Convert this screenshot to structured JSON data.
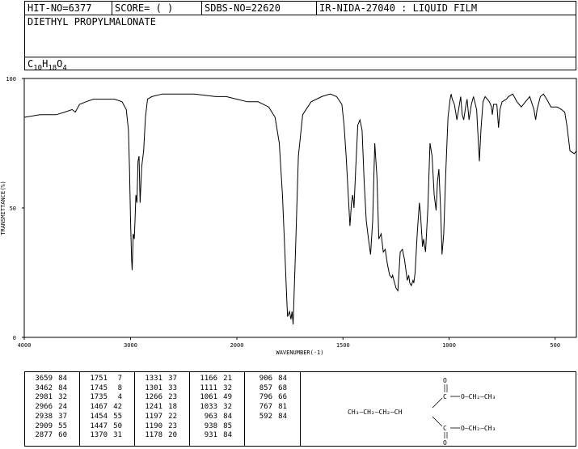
{
  "header": {
    "hit_no": "HIT-NO=6377",
    "score": "SCORE=  (   )",
    "sdbs_no": "SDBS-NO=22620",
    "ir_nida": "IR-NIDA-27040 : LIQUID FILM",
    "compound_name": "DIETHYL PROPYLMALONATE",
    "formula": {
      "c": "C",
      "c_n": "10",
      "h": "H",
      "h_n": "18",
      "o": "O",
      "o_n": "4"
    }
  },
  "chart_data": {
    "type": "line",
    "xlabel": "WAVENUMBER(-1)",
    "ylabel": "TRANSMITTANCE(%)",
    "xlim": [
      4000,
      400
    ],
    "ylim": [
      0,
      100
    ],
    "x_ticks": [
      4000,
      3000,
      2000,
      1500,
      1000,
      500
    ],
    "y_ticks": [
      0,
      50,
      100
    ],
    "grid": false,
    "series": [
      {
        "values": [
          [
            4000,
            85
          ],
          [
            3850,
            86
          ],
          [
            3700,
            86
          ],
          [
            3620,
            87
          ],
          [
            3550,
            88
          ],
          [
            3520,
            87
          ],
          [
            3480,
            90
          ],
          [
            3420,
            91
          ],
          [
            3350,
            92
          ],
          [
            3250,
            92
          ],
          [
            3150,
            92
          ],
          [
            3080,
            91
          ],
          [
            3040,
            88
          ],
          [
            3020,
            80
          ],
          [
            3010,
            65
          ],
          [
            3000,
            45
          ],
          [
            2990,
            30
          ],
          [
            2985,
            26
          ],
          [
            2975,
            40
          ],
          [
            2965,
            38
          ],
          [
            2958,
            45
          ],
          [
            2950,
            55
          ],
          [
            2940,
            52
          ],
          [
            2930,
            68
          ],
          [
            2920,
            70
          ],
          [
            2910,
            52
          ],
          [
            2895,
            66
          ],
          [
            2877,
            72
          ],
          [
            2860,
            85
          ],
          [
            2840,
            92
          ],
          [
            2800,
            93
          ],
          [
            2700,
            94
          ],
          [
            2600,
            94
          ],
          [
            2400,
            94
          ],
          [
            2200,
            93
          ],
          [
            2100,
            93
          ],
          [
            2000,
            92
          ],
          [
            1950,
            91
          ],
          [
            1900,
            91
          ],
          [
            1850,
            89
          ],
          [
            1820,
            85
          ],
          [
            1800,
            75
          ],
          [
            1785,
            55
          ],
          [
            1775,
            35
          ],
          [
            1765,
            15
          ],
          [
            1761,
            8
          ],
          [
            1752,
            10
          ],
          [
            1745,
            7
          ],
          [
            1740,
            10
          ],
          [
            1735,
            5
          ],
          [
            1725,
            30
          ],
          [
            1710,
            70
          ],
          [
            1690,
            86
          ],
          [
            1650,
            91
          ],
          [
            1600,
            93
          ],
          [
            1560,
            94
          ],
          [
            1530,
            93
          ],
          [
            1505,
            90
          ],
          [
            1495,
            82
          ],
          [
            1485,
            70
          ],
          [
            1475,
            55
          ],
          [
            1467,
            43
          ],
          [
            1460,
            52
          ],
          [
            1454,
            55
          ],
          [
            1448,
            50
          ],
          [
            1440,
            65
          ],
          [
            1430,
            82
          ],
          [
            1420,
            84
          ],
          [
            1410,
            80
          ],
          [
            1400,
            60
          ],
          [
            1390,
            45
          ],
          [
            1380,
            38
          ],
          [
            1370,
            32
          ],
          [
            1360,
            45
          ],
          [
            1350,
            75
          ],
          [
            1340,
            62
          ],
          [
            1331,
            38
          ],
          [
            1320,
            40
          ],
          [
            1310,
            33
          ],
          [
            1301,
            34
          ],
          [
            1290,
            28
          ],
          [
            1280,
            24
          ],
          [
            1270,
            23
          ],
          [
            1266,
            24
          ],
          [
            1260,
            22
          ],
          [
            1250,
            19
          ],
          [
            1241,
            18
          ],
          [
            1230,
            33
          ],
          [
            1220,
            34
          ],
          [
            1210,
            30
          ],
          [
            1197,
            22
          ],
          [
            1190,
            24
          ],
          [
            1185,
            21
          ],
          [
            1178,
            20
          ],
          [
            1170,
            22
          ],
          [
            1166,
            21
          ],
          [
            1160,
            25
          ],
          [
            1150,
            40
          ],
          [
            1140,
            52
          ],
          [
            1135,
            48
          ],
          [
            1125,
            35
          ],
          [
            1120,
            38
          ],
          [
            1111,
            33
          ],
          [
            1100,
            50
          ],
          [
            1090,
            75
          ],
          [
            1080,
            70
          ],
          [
            1070,
            55
          ],
          [
            1061,
            49
          ],
          [
            1055,
            60
          ],
          [
            1048,
            65
          ],
          [
            1040,
            50
          ],
          [
            1033,
            32
          ],
          [
            1025,
            40
          ],
          [
            1015,
            65
          ],
          [
            1005,
            85
          ],
          [
            995,
            92
          ],
          [
            990,
            94
          ],
          [
            985,
            92
          ],
          [
            975,
            90
          ],
          [
            963,
            84
          ],
          [
            955,
            88
          ],
          [
            945,
            93
          ],
          [
            938,
            86
          ],
          [
            931,
            84
          ],
          [
            920,
            90
          ],
          [
            915,
            92
          ],
          [
            906,
            84
          ],
          [
            895,
            90
          ],
          [
            885,
            93
          ],
          [
            870,
            88
          ],
          [
            857,
            68
          ],
          [
            850,
            80
          ],
          [
            840,
            91
          ],
          [
            830,
            93
          ],
          [
            820,
            92
          ],
          [
            810,
            91
          ],
          [
            800,
            89
          ],
          [
            796,
            86
          ],
          [
            790,
            90
          ],
          [
            775,
            90
          ],
          [
            767,
            81
          ],
          [
            760,
            88
          ],
          [
            750,
            91
          ],
          [
            730,
            92
          ],
          [
            720,
            93
          ],
          [
            700,
            94
          ],
          [
            680,
            91
          ],
          [
            660,
            89
          ],
          [
            640,
            91
          ],
          [
            620,
            93
          ],
          [
            600,
            88
          ],
          [
            592,
            84
          ],
          [
            585,
            88
          ],
          [
            570,
            93
          ],
          [
            555,
            94
          ],
          [
            540,
            92
          ],
          [
            520,
            89
          ],
          [
            490,
            89
          ],
          [
            470,
            88
          ],
          [
            455,
            87
          ],
          [
            445,
            82
          ],
          [
            430,
            72
          ],
          [
            410,
            71
          ],
          [
            400,
            72
          ]
        ]
      }
    ]
  },
  "peak_table": {
    "columns": [
      [
        [
          "3659",
          "84"
        ],
        [
          "3462",
          "84"
        ],
        [
          "2981",
          "32"
        ],
        [
          "2966",
          "24"
        ],
        [
          "2938",
          "37"
        ],
        [
          "2909",
          "55"
        ],
        [
          "2877",
          "60"
        ]
      ],
      [
        [
          "1751",
          "7"
        ],
        [
          "1745",
          "8"
        ],
        [
          "1735",
          "4"
        ],
        [
          "1467",
          "42"
        ],
        [
          "1454",
          "55"
        ],
        [
          "1447",
          "50"
        ],
        [
          "1370",
          "31"
        ]
      ],
      [
        [
          "1331",
          "37"
        ],
        [
          "1301",
          "33"
        ],
        [
          "1266",
          "23"
        ],
        [
          "1241",
          "18"
        ],
        [
          "1197",
          "22"
        ],
        [
          "1190",
          "23"
        ],
        [
          "1178",
          "20"
        ]
      ],
      [
        [
          "1166",
          "21"
        ],
        [
          "1111",
          "32"
        ],
        [
          "1061",
          "49"
        ],
        [
          "1033",
          "32"
        ],
        [
          "963",
          "84"
        ],
        [
          "938",
          "85"
        ],
        [
          "931",
          "84"
        ]
      ],
      [
        [
          "906",
          "84"
        ],
        [
          "857",
          "68"
        ],
        [
          "796",
          "66"
        ],
        [
          "767",
          "81"
        ],
        [
          "592",
          "84"
        ]
      ]
    ]
  },
  "structure": {
    "chain": "CH₃—CH₂—CH₂—CH",
    "top_o": "O",
    "top_c": "C",
    "top_tail": "O—CH₂—CH₃",
    "bot_c": "C",
    "bot_o": "O",
    "bot_tail": "O—CH₂—CH₃"
  }
}
